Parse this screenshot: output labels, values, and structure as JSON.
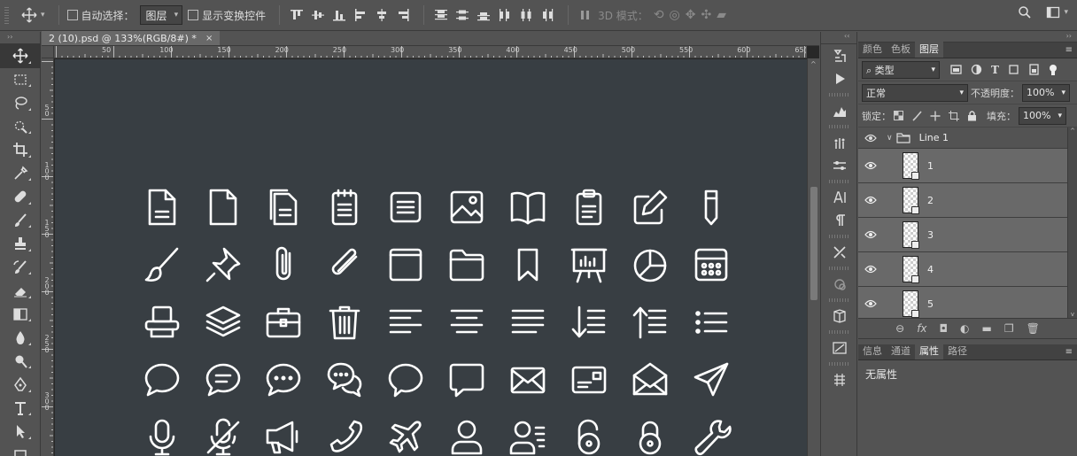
{
  "options_bar": {
    "auto_select_label": "自动选择：",
    "auto_select_value": "图层",
    "show_transform_label": "显示变换控件",
    "mode_3d_label": "3D 模式："
  },
  "document": {
    "tab_title": "2 (10).psd @ 133%(RGB/8#) *",
    "tab_close": "×",
    "ruler_h_labels": [
      "50",
      "100",
      "150",
      "200",
      "250",
      "300",
      "350",
      "400",
      "450",
      "500",
      "550",
      "600",
      "65("
    ],
    "ruler_v_labels": [
      "5\n0",
      "1\n0\n0",
      "1\n5\n0",
      "2\n0\n0",
      "2\n5\n0",
      "3\n0\n0"
    ]
  },
  "panels": {
    "top_tabs": [
      "颜色",
      "色板",
      "图层"
    ],
    "active_top_tab": "图层",
    "filter_kind": "类型",
    "blend_mode": "正常",
    "opacity_label": "不透明度：",
    "opacity_value": "100%",
    "lock_label": "锁定：",
    "fill_label": "填充：",
    "fill_value": "100%",
    "group_name": "Line 1",
    "layers": [
      "1",
      "2",
      "3",
      "4",
      "5"
    ],
    "bottom_tabs": [
      "信息",
      "通道",
      "属性",
      "路径"
    ],
    "active_bottom_tab": "属性",
    "properties_text": "无属性"
  }
}
